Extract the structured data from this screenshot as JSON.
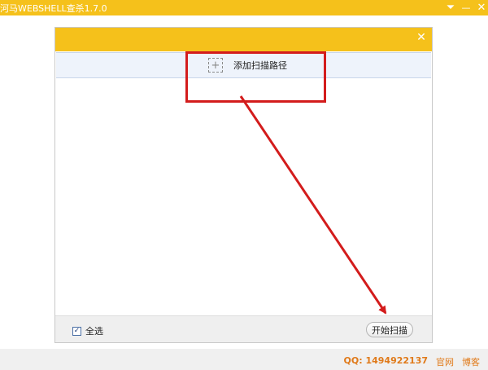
{
  "app": {
    "title": "河马WEBSHELL查杀1.7.0",
    "titlebar_buttons": [
      {
        "icon": "menu-down-icon",
        "glyph": "⏷"
      },
      {
        "icon": "minimize-icon",
        "glyph": "—"
      },
      {
        "icon": "close-icon",
        "glyph": "✕"
      }
    ],
    "accent_color": "#f5c11b"
  },
  "dialog": {
    "close_glyph": "✕",
    "add_path": {
      "plus_glyph": "+",
      "label": "添加扫描路径"
    },
    "footer": {
      "select_all_label": "全选",
      "select_all_checked": true,
      "check_glyph": "✓",
      "start_button_label": "开始扫描"
    }
  },
  "annotation": {
    "color": "#d31c1c"
  },
  "statusbar": {
    "qq_label": "QQ: 1494922137",
    "link_website": "官网",
    "link_blog": "博客",
    "link_color": "#e07a1a"
  }
}
